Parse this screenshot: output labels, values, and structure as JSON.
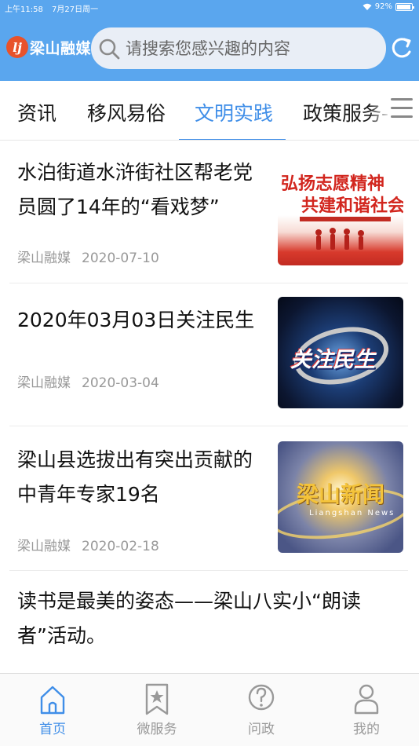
{
  "status_bar": {
    "time": "上午11:58",
    "date": "7月27日周一",
    "battery": "92%",
    "battery_level": 0.92
  },
  "header": {
    "app_name": "梁山融媒",
    "search_placeholder": "请搜索您感兴趣的内容",
    "accent_color": "#5aa6ee"
  },
  "tabs": [
    {
      "label": "资讯",
      "active": false
    },
    {
      "label": "移风易俗",
      "active": false
    },
    {
      "label": "文明实践",
      "active": true
    },
    {
      "label": "政策服务-",
      "active": false
    }
  ],
  "news": [
    {
      "title": "水泊街道水浒街社区帮老党员圆了14年的“看戏梦”",
      "source": "梁山融媒",
      "date": "2020-07-10",
      "thumb_text_1": "弘扬志愿精神",
      "thumb_text_2": "共建和谐社会"
    },
    {
      "title": "2020年03月03日关注民生",
      "source": "梁山融媒",
      "date": "2020-03-04",
      "thumb_text_1": "关注民生"
    },
    {
      "title": "梁山县选拔出有突出贡献的中青年专家19名",
      "source": "梁山融媒",
      "date": "2020-02-18",
      "thumb_text_1": "梁山新闻",
      "thumb_text_2": "Liangshan News"
    },
    {
      "title": "读书是最美的姿态——梁山八实小“朗读者”活动。"
    }
  ],
  "bottom_nav": [
    {
      "label": "首页",
      "icon": "home-icon",
      "active": true
    },
    {
      "label": "微服务",
      "icon": "bookmark-star-icon",
      "active": false
    },
    {
      "label": "问政",
      "icon": "question-icon",
      "active": false
    },
    {
      "label": "我的",
      "icon": "user-icon",
      "active": false
    }
  ]
}
